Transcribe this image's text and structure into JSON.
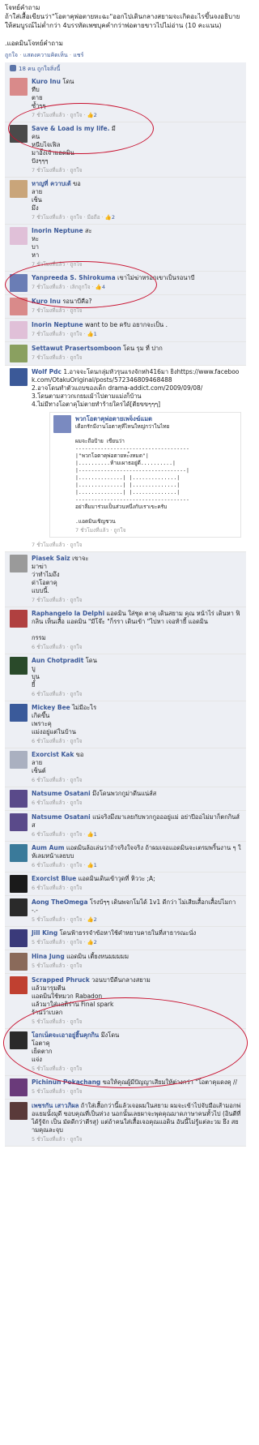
{
  "post": {
    "text": "โจทย์คำถาม\nถ้าใส่เสื้อเขียนว่า\"โอตาคุพ่อตายหะฉะ\"ออกไปเดินกลางสยามจะเกิดอะไรขึ้นจงอธิบายให้สมบูรณ์ไม่ต่ำกว่า 4บรรทัดเพซบุคคำกว่าพ่อตายขาวไปไม่อ่าน (10 คะแนน)\n\n.แอดมินโจทย์คำถาม",
    "actions": [
      "ถูกใจ",
      "แสดงความคิดเห็น",
      "แชร์"
    ],
    "likes_text": "18 คน ถูกใจสิ่งนี้"
  },
  "comments": [
    {
      "name": "Kuro Inu",
      "text": "โดน\nทืบ\nตาย\nซ้ำๆๆ",
      "meta": "7 ชั่วโมงที่แล้ว · ถูกใจ · ",
      "likes": "2",
      "color": "#d98a8a"
    },
    {
      "name": "Save & Load is my life.",
      "text": "มี\nคน\nหนีบไจเฟิล\nมาอั้งเจ้าแอดมิน\nปังๆๆๆ",
      "meta": "7 ชั่วโมงที่แล้ว · ถูกใจ",
      "likes": "",
      "color": "#4a4a4a"
    },
    {
      "name": "หาญที่ ควาบเต้",
      "text": "ขอ\nลาย\nเซ็น\nมึง",
      "meta": "7 ชั่วโมงที่แล้ว · ถูกใจ · มือถือ · ",
      "likes": "2",
      "color": "#c9a57a"
    },
    {
      "name": "Inorin Neptune",
      "text": "สะ\nหะ\nบา\nหา",
      "meta": "7 ชั่วโมงที่แล้ว · ถูกใจ",
      "likes": "",
      "color": "#e0c0d8"
    },
    {
      "name": "Yanpreeda S. Shirokuma",
      "text": "เขาไม่ฆ่าหรอกเขาเป็นรอนาบี",
      "meta": "7 ชั่วโมงที่แล้ว · เลิกถูกใจ · ",
      "likes": "4",
      "color": "#6a7db5"
    },
    {
      "name": "Kuro Inu",
      "text": "รอนาบีคือ?",
      "meta": "7 ชั่วโมงที่แล้ว · ถูกใจ",
      "likes": "",
      "color": "#d98a8a"
    },
    {
      "name": "Inorin Neptune",
      "text": "want to be ครับ อยากจะเป็น .",
      "meta": "7 ชั่วโมงที่แล้ว · ถูกใจ · ",
      "likes": "1",
      "color": "#e0c0d8"
    },
    {
      "name": "Settawut Prasertsomboon",
      "text": "โดน รุม ที่ ปาก",
      "meta": "7 ชั่วโมงที่แล้ว · ถูกใจ",
      "likes": "",
      "color": "#8aa060"
    },
    {
      "name": "Wolf Pdc",
      "text": "1.อาจจะโดนกลุ่มหัวรุนแรงจักหh416มา ยิงhttps://www.facebook.com/OtakuOriginal/posts/572346809468488\n2.อาจโดนทำตัวแถบของเด็ก drama-addict.com/2009/09/08/\n3.โดนตามสาวกเกยมเม้าไปตามแม่งก็บ้าน\n4.ไม่มีทางโอตาคุไม่ตายทำร้ายใครได้[ตียขขๆๆๆ]",
      "meta": "7 ชั่วโมงที่แล้ว · ถูกใจ",
      "likes": "",
      "color": "#3b5998"
    },
    {
      "name": "Piasek Saiz",
      "text": "เขาจะ\nมาฆ่า\nว่าทำไมถึง\nด่าโอตาคุ\nแบบนี้.",
      "meta": "7 ชั่วโมงที่แล้ว · ถูกใจ",
      "likes": "",
      "color": "#9a9a9a"
    },
    {
      "name": "Raphangelo la Delphi",
      "text": "แอดมิน ใส่ชุด ตาคุ เดินสยาม คุณ หน้าไร่ เดินหา ฟิกลิน เห็นเสื้อ แอดมิน \"มีโจ๊ะ \"ก็รรา เดินเข้า \"ไปหา เจอท้ายี้ แอดมิน\n\nกรรม",
      "meta": "6 ชั่วโมงที่แล้ว · ถูกใจ",
      "likes": "",
      "color": "#b04040"
    },
    {
      "name": "Aun Chotpradit",
      "text": "โดน\nบู\nบุน\nยี้",
      "meta": "6 ชั่วโมงที่แล้ว · ถูกใจ",
      "likes": "",
      "color": "#2a4a2a"
    },
    {
      "name": "Mickey Bee",
      "text": "ไม่มีอะไร\nเกิดขึ้น\nเพราะคุ\nแม่งอยู่แต่ในบ้าน",
      "meta": "6 ชั่วโมงที่แล้ว · ถูกใจ",
      "likes": "",
      "color": "#3a5a9a"
    },
    {
      "name": "Exorcist Kak",
      "text": "ขอ\nลาย\nเซ็นต์",
      "meta": "6 ชั่วโมงที่แล้ว · ถูกใจ",
      "likes": "",
      "color": "#aab0c0"
    },
    {
      "name": "Natsume Osatani",
      "text": "มึงโดนพวกกูม่าดีนแน่ส์ส",
      "meta": "6 ชั่วโมงที่แล้ว · ถูกใจ",
      "likes": "",
      "color": "#5a4a8a"
    },
    {
      "name": "Natsume Osatani",
      "text": "แน่จริงมึงมาเลยกับพวกกูอออยู่แม่ อย่าปีออไม่มาก็ตกกินส์ส",
      "meta": "6 ชั่วโมงที่แล้ว · ถูกใจ · ",
      "likes": "1",
      "color": "#5a4a8a"
    },
    {
      "name": "Aum Aum",
      "text": "แอดมินล้อเล่นว่าถ้าจริงใจจริง ถ้าผมเจอแอดมินจะเตรมพริ้นงาน ๆ ให้เลมหน้าเลยบบ",
      "meta": "6 ชั่วโมงที่แล้ว · ถูกใจ · ",
      "likes": "1",
      "color": "#3a7a9a"
    },
    {
      "name": "Exorcist Blue",
      "text": "แอดมินเดินเข้าวุดที่ หิววะ ;A;",
      "meta": "6 ชั่วโมงที่แล้ว · ถูกใจ",
      "likes": "",
      "color": "#1a1a1a"
    },
    {
      "name": "Aong TheOmega",
      "text": "โรงบ้ๆๆ เดินพจกโมได้ 1v1 ดีกว่า ไม่เสียเสื้อกเสื้อบ่ไมกา -.-",
      "meta": "5 ชั่วโมงที่แล้ว · ถูกใจ · ",
      "likes": "2",
      "color": "#2a2a2a"
    },
    {
      "name": "Jill King",
      "text": "โดนฟ้าธรรจำข้อหาใช้คำหยาบคายในที่สาธารณะนั่ง",
      "meta": "5 ชั่วโมงที่แล้ว · ถูกใจ · ",
      "likes": "2",
      "color": "#3a3a7a"
    },
    {
      "name": "Hina Jung",
      "text": "แอดมิน เตี้ยงหนมมมมม",
      "meta": "5 ชั่วโมงที่แล้ว · ถูกใจ",
      "likes": "",
      "color": "#8a6a5a"
    },
    {
      "name": "Scrapped Phruck",
      "text": "วอนบาบีดีนกลางสยาม\nแล้วมารุมตีน\nแอดมินใช้หมวก Rabadon\nแล้วมาใส่แอดิร่าน Final spark\nร้านว่าเบลก",
      "meta": "5 ชั่วโมงที่แล้ว · ถูกใจ",
      "likes": "",
      "color": "#c04030"
    },
    {
      "name": "โอกเน็ตจะเอาอยู่ฮิ้นคุกกิน",
      "text": "มึงโดน\nโอตาคุ\nเย็ดตาก\nแจ่ง",
      "meta": "5 ชั่วโมงที่แล้ว · ถูกใจ",
      "likes": "",
      "color": "#2a2a2a"
    },
    {
      "name": "Pichinun Pokachang",
      "text": "ขอให้คุณผู้มีปัญญาเสียมให้ต่างกว่า \"โอตาคุแดงคุ //",
      "meta": "5 ชั่วโมงที่แล้ว · ถูกใจ",
      "likes": "",
      "color": "#6a3a7a"
    },
    {
      "name": "เพชรกัน เสาวภิผล",
      "text": "ถ้าใส่เสื้อกว่านี้แล้วเจอผมในสยาม ผมจะเข้าไปจับมือเส้ามอกพ่อแยมนั้งมุดี ขอบคุณที่เป็นห่วง นอกนั้นเลยผาจะพุดคุณมาดภาษาคนทั้วไป (อินตีที่ได้รู้จัก เป็น มัดดีกว่าตีรสุ) แต่ถ้าคนใส่เสื้อเจอคุณแอดิน อันนี้ไม่รู้แต่ละวม ยึง สยามคุณละจุบ",
      "meta": "5 ชั่วโมงที่แล้ว · ถูกใจ",
      "likes": "",
      "color": "#5a3a3a"
    }
  ],
  "nested": {
    "name": "พวกโอตาคุพ่อตายเพจ็งฆ์แมต",
    "text": "เดือกรักมีงานโอตาคุที่ไหนใหญ่กว่าในไทย\n\nผมจะถือป้าย เขียนว่า\n------------------------------------\n|\"พวกโอตาคุพ่อตายหะ้งหมด\"|\n|..........ห้ามเผาธอยู่ดี..........|\n|----------------------------------|\n|..............| |..............|\n|..............| |..............|\n|..............| |..............|\n------------------------------------\nอย่าลืมมาร่วมเป็นส่วนหนึ่งกับเราเขะครับ\n\n.แอดมินเชิญชวน",
    "meta": "7 ชั่วโมงที่แล้ว · ถูกใจ",
    "color": "#7a8ac0"
  }
}
